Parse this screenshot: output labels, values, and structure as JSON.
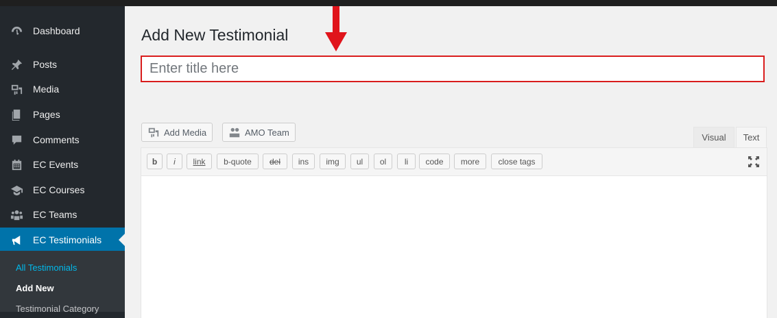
{
  "sidebar": {
    "items": [
      {
        "label": "Dashboard",
        "icon": "dashboard-icon"
      },
      {
        "label": "Posts",
        "icon": "pin-icon"
      },
      {
        "label": "Media",
        "icon": "media-icon"
      },
      {
        "label": "Pages",
        "icon": "pages-icon"
      },
      {
        "label": "Comments",
        "icon": "comment-icon"
      },
      {
        "label": "EC Events",
        "icon": "calendar-icon"
      },
      {
        "label": "EC Courses",
        "icon": "graduation-cap-icon"
      },
      {
        "label": "EC Teams",
        "icon": "groups-icon"
      },
      {
        "label": "EC Testimonials",
        "icon": "megaphone-icon",
        "active": true
      }
    ],
    "submenu": [
      {
        "label": "All Testimonials"
      },
      {
        "label": "Add New"
      },
      {
        "label": "Testimonial Category"
      }
    ]
  },
  "main": {
    "title": "Add New Testimonial",
    "title_placeholder": "Enter title here",
    "title_value": "",
    "media_buttons": [
      {
        "label": "Add Media",
        "icon": "media-icon"
      },
      {
        "label": "AMO Team",
        "icon": "groups-icon"
      }
    ],
    "editor_tabs": [
      {
        "label": "Visual"
      },
      {
        "label": "Text",
        "active": true
      }
    ],
    "quicktags": [
      "b",
      "i",
      "link",
      "b-quote",
      "del",
      "ins",
      "img",
      "ul",
      "ol",
      "li",
      "code",
      "more",
      "close tags"
    ]
  },
  "colors": {
    "sidebar_bg": "#23282d",
    "accent": "#0073aa",
    "annotation_red": "#d91c1c"
  }
}
